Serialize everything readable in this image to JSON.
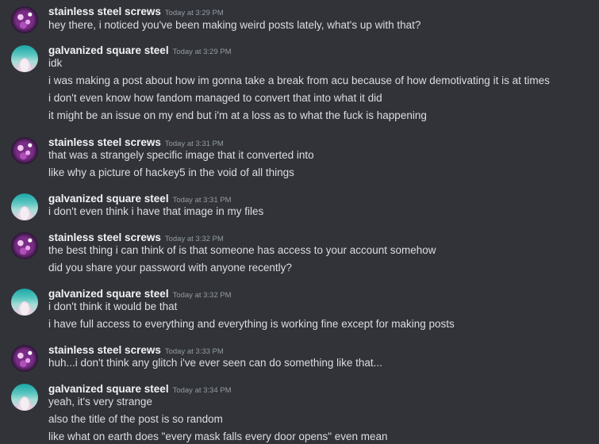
{
  "messages": [
    {
      "username": "stainless steel screws",
      "timestamp": "Today at 3:29 PM",
      "avatar": "screws",
      "lines": [
        "hey there, i noticed you've been making weird posts lately, what's up with that?"
      ]
    },
    {
      "username": "galvanized square steel",
      "timestamp": "Today at 3:29 PM",
      "avatar": "steel",
      "lines": [
        "idk",
        "i was making a post about how im gonna take a break from acu because of how demotivating it is at times",
        "i don't even know how fandom managed to convert that into what it did",
        "it might be an issue on my end but i'm at a loss as to what the fuck is happening"
      ]
    },
    {
      "username": "stainless steel screws",
      "timestamp": "Today at 3:31 PM",
      "avatar": "screws",
      "lines": [
        "that was a strangely specific image that it converted into",
        "like why a picture of hackey5 in the void of all things"
      ]
    },
    {
      "username": "galvanized square steel",
      "timestamp": "Today at 3:31 PM",
      "avatar": "steel",
      "lines": [
        "i don't even think i have that image in my files"
      ]
    },
    {
      "username": "stainless steel screws",
      "timestamp": "Today at 3:32 PM",
      "avatar": "screws",
      "lines": [
        "the best thing i can think of is that someone has access to your account somehow",
        "did you share your password with anyone recently?"
      ]
    },
    {
      "username": "galvanized square steel",
      "timestamp": "Today at 3:32 PM",
      "avatar": "steel",
      "lines": [
        "i don't think it would be that",
        "i have full access to everything and everything is working fine except for making posts"
      ]
    },
    {
      "username": "stainless steel screws",
      "timestamp": "Today at 3:33 PM",
      "avatar": "screws",
      "lines": [
        "huh...i don't think any glitch i've ever seen can do something like that..."
      ]
    },
    {
      "username": "galvanized square steel",
      "timestamp": "Today at 3:34 PM",
      "avatar": "steel",
      "lines": [
        "yeah, it's very strange",
        "also the title of the post is so random",
        "like what on earth does \"every mask falls every door opens\" even mean"
      ]
    }
  ]
}
